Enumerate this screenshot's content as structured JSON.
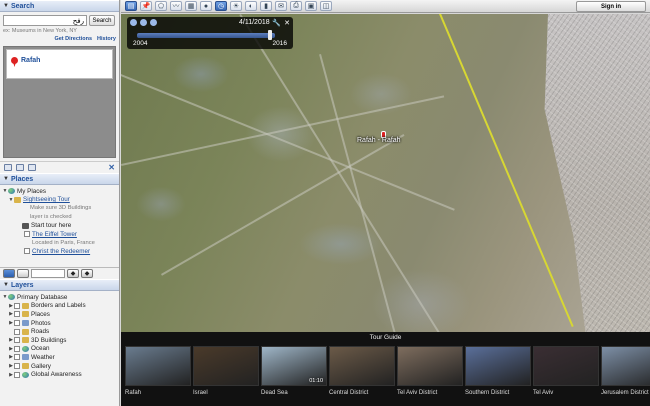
{
  "search": {
    "title": "Search",
    "input_value": "رفح",
    "button_label": "Search",
    "hint": "ex: Museums in New York, NY",
    "get_directions": "Get Directions",
    "history": "History",
    "result": "Rafah"
  },
  "places": {
    "title": "Places",
    "my_places": "My Places",
    "sightseeing_tour": "Sightseeing Tour",
    "note1": "Make sure 3D Buildings",
    "note2": "layer is checked",
    "start_tour": "Start tour here",
    "eiffel": "The Eiffel Tower",
    "eiffel_loc": "Located in Paris, France",
    "christ": "Christ the Redeemer"
  },
  "layers": {
    "title": "Layers",
    "items": [
      "Primary Database",
      "Borders and Labels",
      "Places",
      "Photos",
      "Roads",
      "3D Buildings",
      "Ocean",
      "Weather",
      "Gallery",
      "Global Awareness"
    ]
  },
  "toolbar": {
    "signin": "Sign in"
  },
  "timeline": {
    "date": "4/11/2018",
    "start_year": "2004",
    "end_year": "2016",
    "position": 0.98
  },
  "map": {
    "label": "Rafah - Rafah"
  },
  "tour": {
    "title": "Tour Guide",
    "items": [
      {
        "caption": "Rafah",
        "duration": ""
      },
      {
        "caption": "Israel",
        "duration": ""
      },
      {
        "caption": "Dead Sea",
        "duration": "01:10"
      },
      {
        "caption": "Central District",
        "duration": ""
      },
      {
        "caption": "Tel Aviv District",
        "duration": ""
      },
      {
        "caption": "Southern District",
        "duration": ""
      },
      {
        "caption": "Tel Aviv",
        "duration": ""
      },
      {
        "caption": "Jerusalem District",
        "duration": ""
      }
    ],
    "colors": [
      "#6a7c8f",
      "#4a3a2a",
      "#9fb6c8",
      "#6b5a48",
      "#7e6d5e",
      "#5a6f9a",
      "#3a2e33",
      "#7d8fa6"
    ]
  }
}
